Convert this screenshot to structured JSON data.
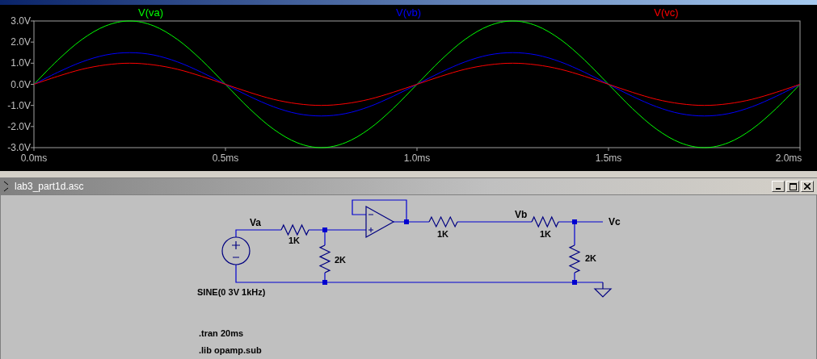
{
  "plot_window": {
    "chart_data": {
      "type": "line",
      "x": [
        0,
        0.0625,
        0.125,
        0.1875,
        0.25,
        0.3125,
        0.375,
        0.4375,
        0.5,
        0.5625,
        0.625,
        0.6875,
        0.75,
        0.8125,
        0.875,
        0.9375,
        1,
        1.0625,
        1.125,
        1.1875,
        1.25,
        1.3125,
        1.375,
        1.4375,
        1.5,
        1.5625,
        1.625,
        1.6875,
        1.75,
        1.8125,
        1.875,
        1.9375,
        2
      ],
      "series": [
        {
          "name": "V(va)",
          "color": "#00ff00",
          "values": [
            0,
            1.15,
            2.12,
            2.77,
            3,
            2.77,
            2.12,
            1.15,
            0,
            -1.15,
            -2.12,
            -2.77,
            -3,
            -2.77,
            -2.12,
            -1.15,
            0,
            1.15,
            2.12,
            2.77,
            3,
            2.77,
            2.12,
            1.15,
            0,
            -1.15,
            -2.12,
            -2.77,
            -3,
            -2.77,
            -2.12,
            -1.15,
            0
          ]
        },
        {
          "name": "V(vb)",
          "color": "#0000ff",
          "values": [
            0,
            0.57,
            1.06,
            1.39,
            1.5,
            1.39,
            1.06,
            0.57,
            0,
            -0.57,
            -1.06,
            -1.39,
            -1.5,
            -1.39,
            -1.06,
            -0.57,
            0,
            0.57,
            1.06,
            1.39,
            1.5,
            1.39,
            1.06,
            0.57,
            0,
            -0.57,
            -1.06,
            -1.39,
            -1.5,
            -1.39,
            -1.06,
            -0.57,
            0
          ]
        },
        {
          "name": "V(vc)",
          "color": "#ff0000",
          "values": [
            0,
            0.38,
            0.71,
            0.92,
            1,
            0.92,
            0.71,
            0.38,
            0,
            -0.38,
            -0.71,
            -0.92,
            -1,
            -0.92,
            -0.71,
            -0.38,
            0,
            0.38,
            0.71,
            0.92,
            1,
            0.92,
            0.71,
            0.38,
            0,
            -0.38,
            -0.71,
            -0.92,
            -1,
            -0.92,
            -0.71,
            -0.38,
            0
          ]
        }
      ],
      "xlim": [
        0,
        2
      ],
      "ylim": [
        -3,
        3
      ],
      "xticks": [
        {
          "value": 0,
          "label": "0.0ms"
        },
        {
          "value": 0.5,
          "label": "0.5ms"
        },
        {
          "value": 1,
          "label": "1.0ms"
        },
        {
          "value": 1.5,
          "label": "1.5ms"
        },
        {
          "value": 2,
          "label": "2.0ms"
        }
      ],
      "yticks": [
        {
          "value": 3,
          "label": "3.0V"
        },
        {
          "value": 2,
          "label": "2.0V"
        },
        {
          "value": 1,
          "label": "1.0V"
        },
        {
          "value": 0,
          "label": "0.0V"
        },
        {
          "value": -1,
          "label": "-1.0V"
        },
        {
          "value": -2,
          "label": "-2.0V"
        },
        {
          "value": -3,
          "label": "-3.0V"
        }
      ]
    }
  },
  "schematic_window": {
    "title": "lab3_part1d.asc",
    "net_labels": [
      "Va",
      "Vb",
      "Vc"
    ],
    "components": [
      {
        "kind": "voltage_source",
        "value": "SINE(0 3V 1kHz)"
      },
      {
        "kind": "resistor",
        "value": "1K"
      },
      {
        "kind": "resistor",
        "value": "2K"
      },
      {
        "kind": "opamp"
      },
      {
        "kind": "resistor",
        "value": "1K"
      },
      {
        "kind": "resistor",
        "value": "1K"
      },
      {
        "kind": "resistor",
        "value": "2K"
      },
      {
        "kind": "ground"
      }
    ],
    "directives": [
      ".tran 20ms",
      ".lib opamp.sub"
    ]
  }
}
